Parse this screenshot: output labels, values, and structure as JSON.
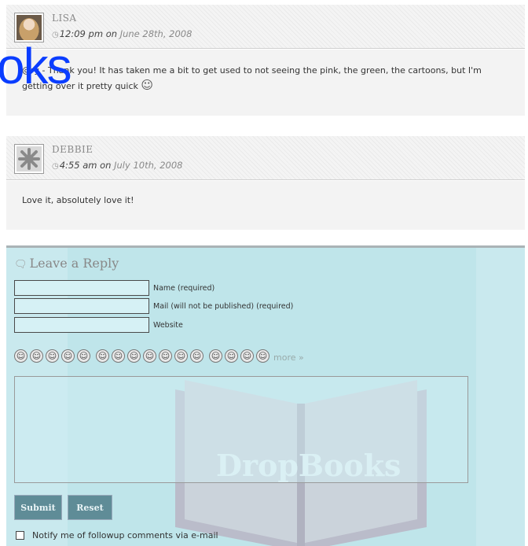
{
  "comments": [
    {
      "author": "LISA",
      "time": "12:09 pm",
      "on": "on",
      "date": "June 28th, 2008",
      "text": "@ry - Thank you! It has taken me a bit to get used to not seeing the pink, the green, the cartoons, but I'm getting over it pretty quick",
      "avatar_icon": "user-photo-icon"
    },
    {
      "author": "DEBBIE",
      "time": "4:55 am",
      "on": "on",
      "date": "July 10th, 2008",
      "text": "Love it, absolutely love it!",
      "avatar_icon": "default-avatar-icon"
    }
  ],
  "overlay_text": "oks",
  "reply": {
    "title": "Leave a Reply",
    "fields": [
      {
        "label": "Name (required)",
        "value": ""
      },
      {
        "label": "Mail (will not be published) (required)",
        "value": ""
      },
      {
        "label": "Website",
        "value": ""
      }
    ],
    "smileys": [
      "smile",
      "grin",
      "cool",
      "wink",
      "shocked",
      "tongue",
      "laugh",
      "surprised",
      "neutral",
      "cry",
      "confused",
      "eek",
      "sad",
      "happy",
      "mad",
      "lol"
    ],
    "more_link": "more »",
    "submit_label": "Submit",
    "reset_label": "Reset",
    "notify_label": "Notify me of followup comments via e-mail"
  },
  "watermark_text": "DropBooks",
  "colors": {
    "reply_bg": "#c9e9ee",
    "button_bg": "#5f8c97",
    "overlay_blue": "#0a3dff"
  }
}
